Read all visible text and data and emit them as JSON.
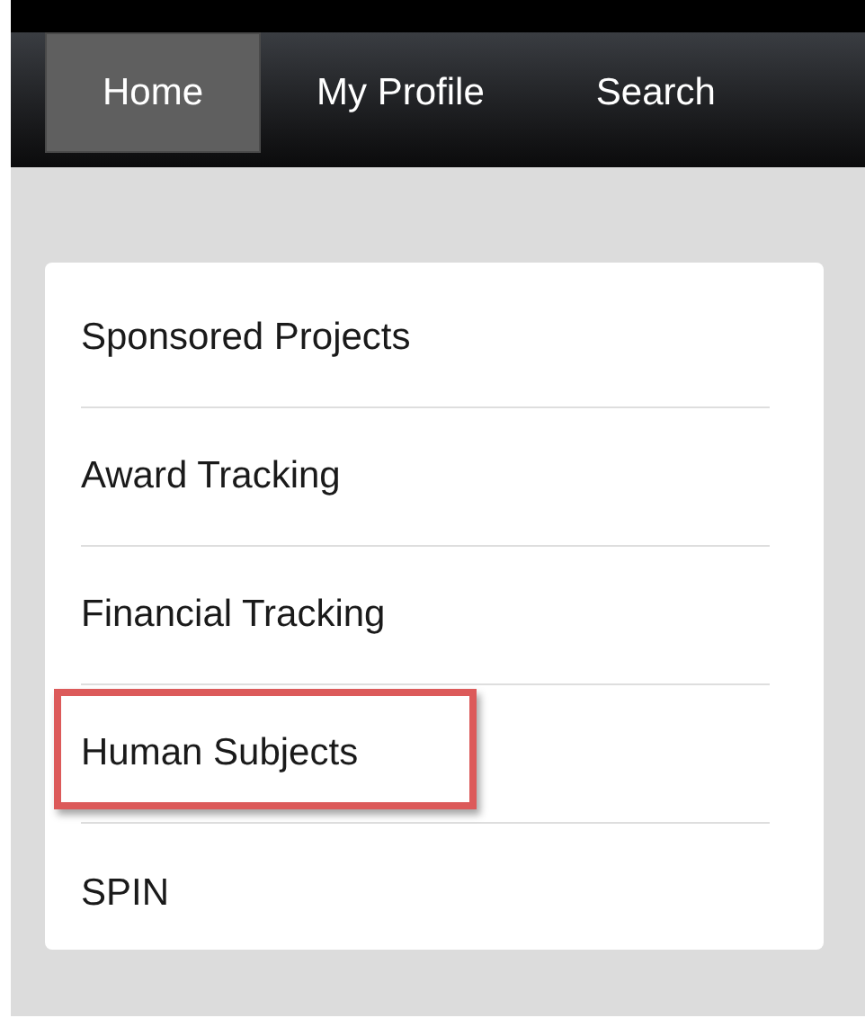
{
  "nav": {
    "tabs": [
      {
        "label": "Home",
        "selected": true
      },
      {
        "label": "My Profile",
        "selected": false
      },
      {
        "label": "Search",
        "selected": false
      }
    ]
  },
  "menu": {
    "items": [
      {
        "label": "Sponsored Projects",
        "highlighted": false
      },
      {
        "label": "Award Tracking",
        "highlighted": false
      },
      {
        "label": "Financial Tracking",
        "highlighted": false
      },
      {
        "label": "Human Subjects",
        "highlighted": true
      },
      {
        "label": "SPIN",
        "highlighted": false
      }
    ]
  }
}
